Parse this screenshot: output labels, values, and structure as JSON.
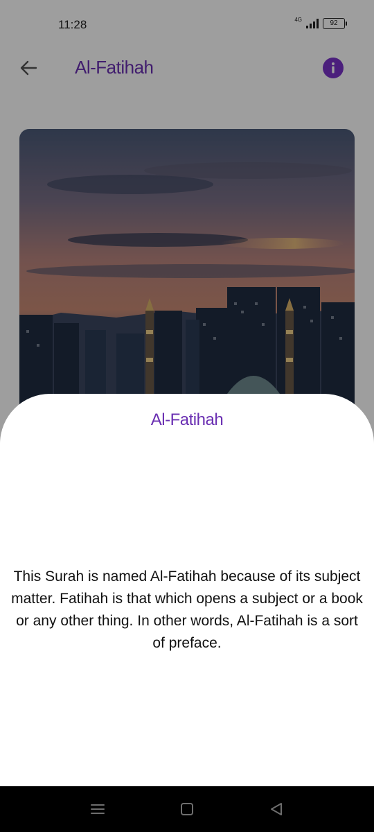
{
  "status_bar": {
    "time": "11:28",
    "network": "4G",
    "battery": "92"
  },
  "app_bar": {
    "title": "Al-Fatihah",
    "back_icon": "arrow-left-icon",
    "info_icon": "info-icon"
  },
  "hero_image": {
    "description_icon": "mosque-sunset-image"
  },
  "sheet": {
    "title": "Al-Fatihah",
    "body": "This Surah is named Al-Fatihah because of its subject matter. Fatihah is that which opens a subject or a book or any other thing. In other words, Al-Fatihah is a sort of preface."
  },
  "nav_bar": {
    "recents_icon": "menu-lines-icon",
    "home_icon": "square-icon",
    "back_icon": "triangle-back-icon"
  },
  "colors": {
    "accent": "#6a2fb2",
    "info_button": "#7a33c8",
    "scrim": "rgba(0,0,0,0.38)",
    "nav_bar": "#000000"
  }
}
